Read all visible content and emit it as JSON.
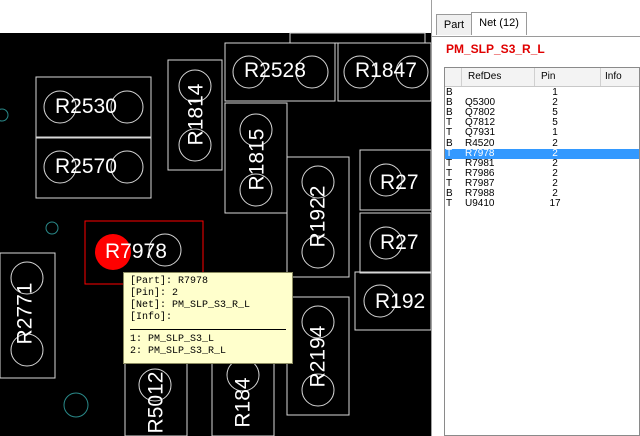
{
  "pcb": {
    "labels": {
      "r2528": "R2528",
      "r1847": "R1847",
      "r2530": "R2530",
      "r1814": "R1814",
      "r1815": "R1815",
      "r2570": "R2570",
      "r1922": "R1922",
      "r27a": "R27",
      "r27b": "R27",
      "r7978": "R7978",
      "r2771": "R2771",
      "r192": "R192",
      "r2194": "R2194",
      "r5012": "R5012",
      "r184": "R184"
    },
    "highlight_color": "#ff0000",
    "outline_color": "#d8d8d8"
  },
  "tooltip": {
    "part": "[Part]: R7978",
    "pin": "[Pin]: 2",
    "net": "[Net]: PM_SLP_S3_R_L",
    "info": "[Info]:",
    "conn1": "1: PM_SLP_S3_L",
    "conn2": "2: PM_SLP_S3_R_L"
  },
  "panel": {
    "tabs": [
      {
        "label": "Part"
      },
      {
        "label": "Net (12)"
      }
    ],
    "net_name": "PM_SLP_S3_R_L",
    "columns": [
      "RefDes",
      "Pin",
      "Info"
    ],
    "rows": [
      {
        "side": "B",
        "ref": "",
        "pin": "1"
      },
      {
        "side": "B",
        "ref": "Q5300",
        "pin": "2"
      },
      {
        "side": "B",
        "ref": "Q7802",
        "pin": "5"
      },
      {
        "side": "T",
        "ref": "Q7812",
        "pin": "5"
      },
      {
        "side": "T",
        "ref": "Q7931",
        "pin": "1"
      },
      {
        "side": "B",
        "ref": "R4520",
        "pin": "2"
      },
      {
        "side": "T",
        "ref": "R7978",
        "pin": "2"
      },
      {
        "side": "T",
        "ref": "R7981",
        "pin": "2"
      },
      {
        "side": "T",
        "ref": "R7986",
        "pin": "2"
      },
      {
        "side": "T",
        "ref": "R7987",
        "pin": "2"
      },
      {
        "side": "B",
        "ref": "R7988",
        "pin": "2"
      },
      {
        "side": "T",
        "ref": "U9410",
        "pin": "17"
      }
    ]
  }
}
